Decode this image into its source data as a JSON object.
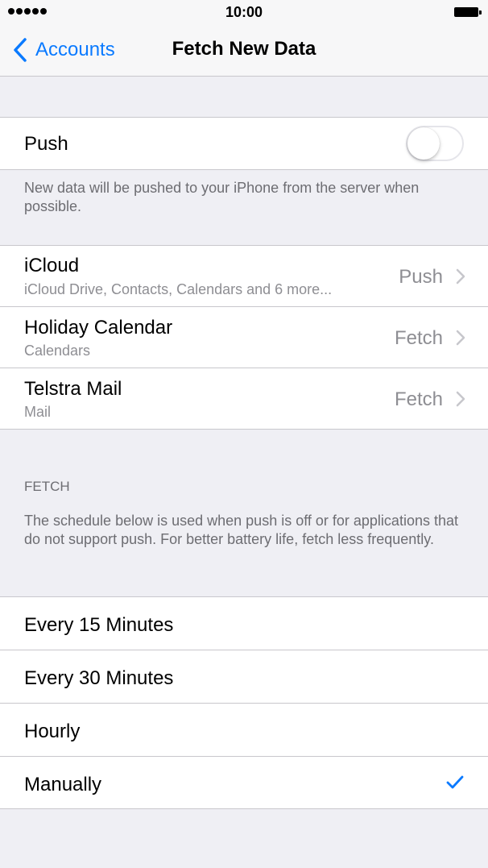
{
  "status": {
    "time": "10:00",
    "signal_icon": "signal-dots-icon",
    "battery_icon": "battery-icon"
  },
  "nav": {
    "back_label": "Accounts",
    "title": "Fetch New Data",
    "accent_color": "#0a7aff"
  },
  "push": {
    "label": "Push",
    "enabled": false,
    "footer": "New data will be pushed to your iPhone from the server when possible."
  },
  "accounts": [
    {
      "name": "iCloud",
      "detail": "iCloud Drive, Contacts, Calendars and 6 more...",
      "value": "Push"
    },
    {
      "name": "Holiday Calendar",
      "detail": "Calendars",
      "value": "Fetch"
    },
    {
      "name": "Telstra Mail",
      "detail": "Mail",
      "value": "Fetch"
    }
  ],
  "fetch": {
    "header": "FETCH",
    "description": "The schedule below is used when push is off or for applications that do not support push. For better battery life, fetch less frequently.",
    "options": [
      {
        "label": "Every 15 Minutes",
        "selected": false
      },
      {
        "label": "Every 30 Minutes",
        "selected": false
      },
      {
        "label": "Hourly",
        "selected": false
      },
      {
        "label": "Manually",
        "selected": true
      }
    ]
  }
}
